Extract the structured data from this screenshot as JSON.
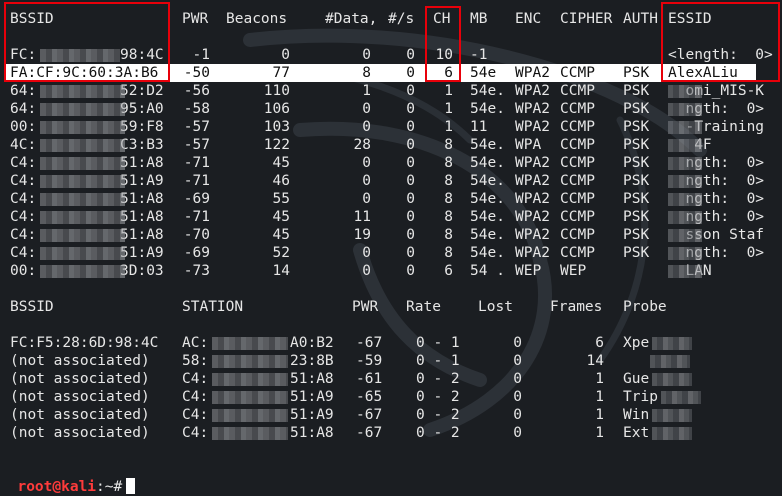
{
  "ap_header": {
    "bssid": "BSSID",
    "pwr": "PWR",
    "beacons": "Beacons",
    "data": "#Data,",
    "s": "#/s",
    "ch": "CH",
    "mb": "MB",
    "enc": "ENC",
    "cipher": "CIPHER",
    "auth": "AUTH",
    "essid": "ESSID"
  },
  "ap_rows": [
    {
      "b1": "FC:",
      "b2": "98:4C",
      "pwr": "-1",
      "beacons": "0",
      "data": "0",
      "s": "0",
      "ch": "10",
      "mb": "-1",
      "enc": "",
      "cipher": "",
      "auth": "",
      "essid": "<length:  0>",
      "highlight": false,
      "blur_essid": false
    },
    {
      "b1": "FA:CF:9C:60:3A:B6",
      "b2": "",
      "pwr": "-50",
      "beacons": "77",
      "data": "8",
      "s": "0",
      "ch": "6",
      "mb": "54e",
      "enc": "WPA2",
      "cipher": "CCMP",
      "auth": "PSK",
      "essid": "AlexALiu",
      "highlight": true,
      "blur_essid": false
    },
    {
      "b1": "64:",
      "b2": "52:D2",
      "pwr": "-56",
      "beacons": "110",
      "data": "1",
      "s": "0",
      "ch": "1",
      "mb": "54e.",
      "enc": "WPA2",
      "cipher": "CCMP",
      "auth": "PSK",
      "essid": "  omi_MIS-K",
      "highlight": false,
      "blur_essid": true
    },
    {
      "b1": "64:",
      "b2": "95:A0",
      "pwr": "-58",
      "beacons": "106",
      "data": "0",
      "s": "0",
      "ch": "1",
      "mb": "54e.",
      "enc": "WPA2",
      "cipher": "CCMP",
      "auth": "PSK",
      "essid": "  ngth:  0>",
      "highlight": false,
      "blur_essid": true
    },
    {
      "b1": "00:",
      "b2": "59:F8",
      "pwr": "-57",
      "beacons": "103",
      "data": "0",
      "s": "0",
      "ch": "1",
      "mb": "11",
      "enc": "WPA2",
      "cipher": "CCMP",
      "auth": "PSK",
      "essid": "  -Training",
      "highlight": false,
      "blur_essid": true
    },
    {
      "b1": "4C:",
      "b2": "C3:B3",
      "pwr": "-57",
      "beacons": "122",
      "data": "28",
      "s": "0",
      "ch": "8",
      "mb": "54e.",
      "enc": "WPA",
      "cipher": "CCMP",
      "auth": "PSK",
      "essid": "   4F",
      "highlight": false,
      "blur_essid": true
    },
    {
      "b1": "C4:",
      "b2": "51:A8",
      "pwr": "-71",
      "beacons": "45",
      "data": "0",
      "s": "0",
      "ch": "8",
      "mb": "54e.",
      "enc": "WPA2",
      "cipher": "CCMP",
      "auth": "PSK",
      "essid": "  ngth:  0>",
      "highlight": false,
      "blur_essid": true
    },
    {
      "b1": "C4:",
      "b2": "51:A9",
      "pwr": "-71",
      "beacons": "46",
      "data": "0",
      "s": "0",
      "ch": "8",
      "mb": "54e.",
      "enc": "WPA2",
      "cipher": "CCMP",
      "auth": "PSK",
      "essid": "  ngth:  0>",
      "highlight": false,
      "blur_essid": true
    },
    {
      "b1": "C4:",
      "b2": "51:A8",
      "pwr": "-69",
      "beacons": "55",
      "data": "0",
      "s": "0",
      "ch": "8",
      "mb": "54e.",
      "enc": "WPA2",
      "cipher": "CCMP",
      "auth": "PSK",
      "essid": "  ngth:  0>",
      "highlight": false,
      "blur_essid": true
    },
    {
      "b1": "C4:",
      "b2": "51:A8",
      "pwr": "-71",
      "beacons": "45",
      "data": "11",
      "s": "0",
      "ch": "8",
      "mb": "54e.",
      "enc": "WPA2",
      "cipher": "CCMP",
      "auth": "PSK",
      "essid": "  ngth:  0>",
      "highlight": false,
      "blur_essid": true
    },
    {
      "b1": "C4:",
      "b2": "51:A8",
      "pwr": "-70",
      "beacons": "45",
      "data": "19",
      "s": "0",
      "ch": "8",
      "mb": "54e.",
      "enc": "WPA2",
      "cipher": "CCMP",
      "auth": "PSK",
      "essid": "  sson Staf",
      "highlight": false,
      "blur_essid": true
    },
    {
      "b1": "C4:",
      "b2": "51:A9",
      "pwr": "-69",
      "beacons": "52",
      "data": "0",
      "s": "0",
      "ch": "8",
      "mb": "54e.",
      "enc": "WPA2",
      "cipher": "CCMP",
      "auth": "PSK",
      "essid": "  ngth:  0>",
      "highlight": false,
      "blur_essid": true
    },
    {
      "b1": "00:",
      "b2": "3D:03",
      "pwr": "-73",
      "beacons": "14",
      "data": "0",
      "s": "0",
      "ch": "6",
      "mb": "54 .",
      "enc": "WEP",
      "cipher": "WEP",
      "auth": "",
      "essid": "  LAN",
      "highlight": false,
      "blur_essid": true
    }
  ],
  "st_header": {
    "bssid": "BSSID",
    "station": "STATION",
    "pwr": "PWR",
    "rate": "Rate",
    "lost": "Lost",
    "frames": "Frames",
    "probe": "Probe"
  },
  "st_rows": [
    {
      "bssid": "FC:F5:28:6D:98:4C",
      "s1": "AC:",
      "s2": "A0:B2",
      "pwr": "-67",
      "rate": "0 - 1",
      "lost": "0",
      "frames": "6",
      "probe": "Xpe"
    },
    {
      "bssid": "(not associated)",
      "s1": "58:",
      "s2": "23:8B",
      "pwr": "-59",
      "rate": "0 - 1",
      "lost": "0",
      "frames": "14",
      "probe": ""
    },
    {
      "bssid": "(not associated)",
      "s1": "C4:",
      "s2": "51:A8",
      "pwr": "-61",
      "rate": "0 - 2",
      "lost": "0",
      "frames": "1",
      "probe": "Gue"
    },
    {
      "bssid": "(not associated)",
      "s1": "C4:",
      "s2": "51:A9",
      "pwr": "-65",
      "rate": "0 - 2",
      "lost": "0",
      "frames": "1",
      "probe": "Trip"
    },
    {
      "bssid": "(not associated)",
      "s1": "C4:",
      "s2": "51:A9",
      "pwr": "-67",
      "rate": "0 - 2",
      "lost": "0",
      "frames": "1",
      "probe": "Win"
    },
    {
      "bssid": "(not associated)",
      "s1": "C4:",
      "s2": "51:A8",
      "pwr": "-67",
      "rate": "0 - 2",
      "lost": "0",
      "frames": "1",
      "probe": "Ext"
    }
  ],
  "prompt": {
    "user": "root@kali",
    "path": ":~#"
  },
  "colors": {
    "background": "#1b1e22",
    "text": "#e6e6e6",
    "highlight_row": "#ffffff",
    "annotation_box": "#e8000a",
    "root_prompt": "#ff3b3b"
  }
}
